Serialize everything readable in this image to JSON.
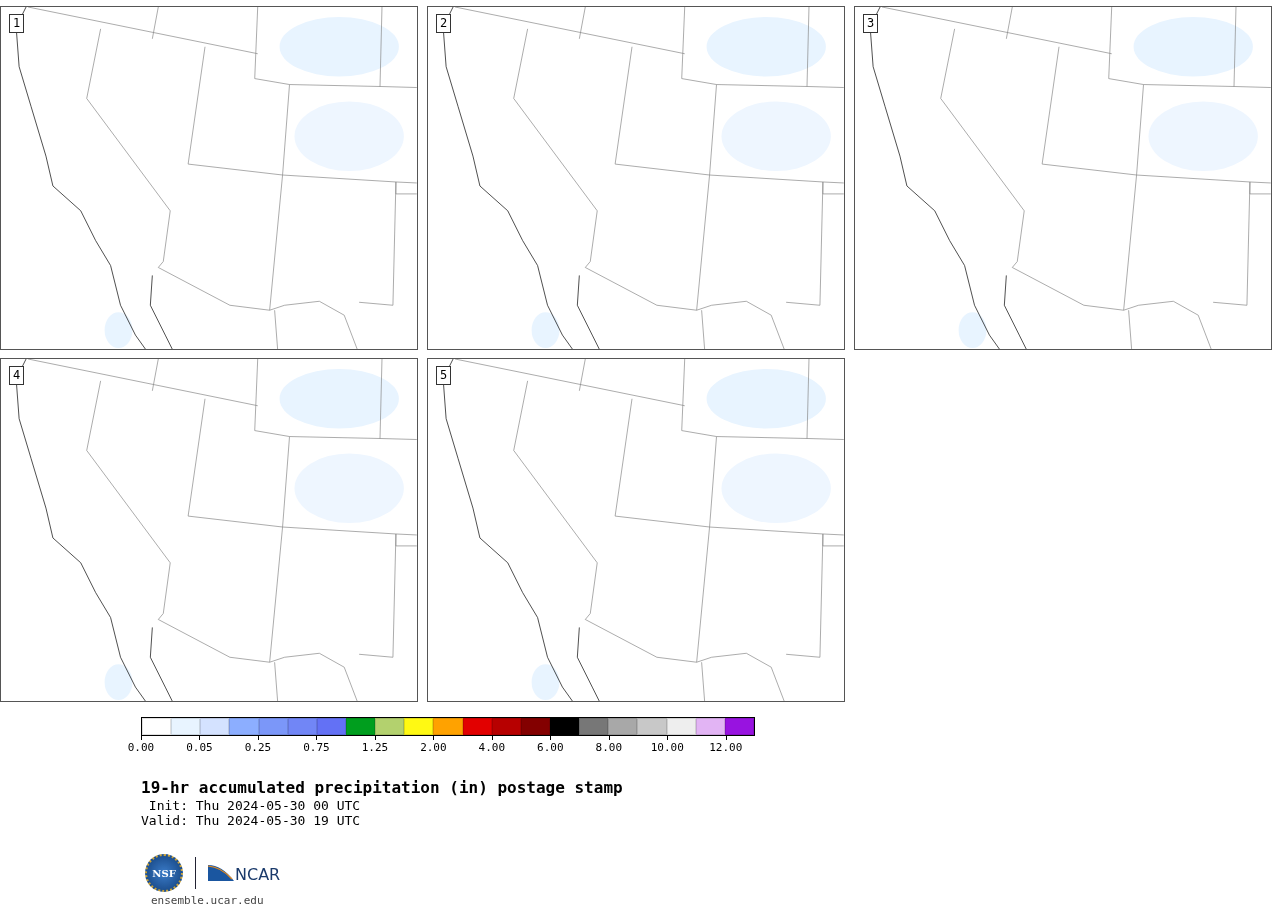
{
  "panels": [
    {
      "label": "1"
    },
    {
      "label": "2"
    },
    {
      "label": "3"
    },
    {
      "label": "4"
    },
    {
      "label": "5"
    }
  ],
  "colorbar": {
    "segments": [
      {
        "color": "#ffffff"
      },
      {
        "color": "#e8f4ff"
      },
      {
        "color": "#d4e2ff"
      },
      {
        "color": "#8caeff"
      },
      {
        "color": "#7b97f9"
      },
      {
        "color": "#7186f6"
      },
      {
        "color": "#6371f5"
      },
      {
        "color": "#009e1e"
      },
      {
        "color": "#b3d16e"
      },
      {
        "color": "#fff913"
      },
      {
        "color": "#ffa200"
      },
      {
        "color": "#e20000"
      },
      {
        "color": "#b70000"
      },
      {
        "color": "#830000"
      },
      {
        "color": "#000000"
      },
      {
        "color": "#777777"
      },
      {
        "color": "#a8a8a8"
      },
      {
        "color": "#c8c8c8"
      },
      {
        "color": "#eeeeee"
      },
      {
        "color": "#e2b4f4"
      },
      {
        "color": "#9813e0"
      }
    ],
    "ticks": [
      "0.00",
      "0.05",
      "0.25",
      "0.75",
      "1.25",
      "2.00",
      "4.00",
      "6.00",
      "8.00",
      "10.00",
      "12.00"
    ]
  },
  "title": "19-hr accumulated precipitation (in) postage stamp",
  "init": " Init: Thu 2024-05-30 00 UTC",
  "valid": "Valid: Thu 2024-05-30 19 UTC",
  "logo": {
    "nsf": "NSF",
    "ncar": "NCAR"
  },
  "url": "ensemble.ucar.edu"
}
